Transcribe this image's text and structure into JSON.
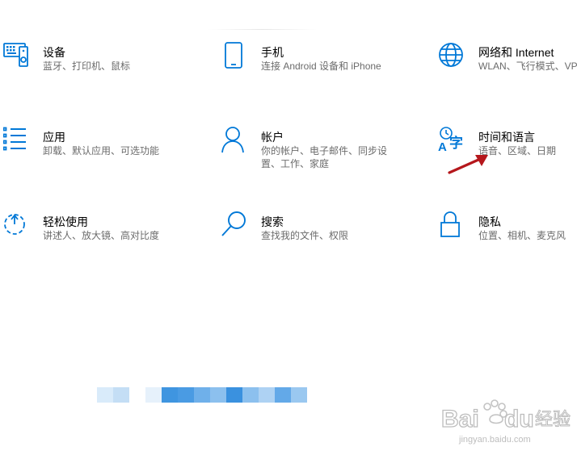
{
  "tiles": [
    {
      "key": "devices",
      "title": "设备",
      "desc": [
        "蓝牙、打印机、鼠标"
      ],
      "icon": "keyboard-speaker-icon"
    },
    {
      "key": "phone",
      "title": "手机",
      "desc": [
        "连接 Android 设备和 iPhone"
      ],
      "icon": "phone-icon"
    },
    {
      "key": "network",
      "title": "网络和 Internet",
      "desc": [
        "WLAN、飞行模式、VP"
      ],
      "icon": "globe-icon"
    },
    {
      "key": "apps",
      "title": "应用",
      "desc": [
        "卸载、默认应用、可选功能"
      ],
      "icon": "apps-list-icon"
    },
    {
      "key": "accounts",
      "title": "帐户",
      "desc": [
        "你的帐户、电子邮件、同步设",
        "置、工作、家庭"
      ],
      "icon": "person-icon"
    },
    {
      "key": "time-language",
      "title": "时间和语言",
      "desc": [
        "语音、区域、日期"
      ],
      "icon": "time-language-icon"
    },
    {
      "key": "ease-of-access",
      "title": "轻松使用",
      "desc": [
        "讲述人、放大镜、高对比度"
      ],
      "icon": "ease-of-access-icon"
    },
    {
      "key": "search",
      "title": "搜索",
      "desc": [
        "查找我的文件、权限"
      ],
      "icon": "search-icon"
    },
    {
      "key": "privacy",
      "title": "隐私",
      "desc": [
        "位置、相机、麦克风"
      ],
      "icon": "lock-icon"
    }
  ],
  "watermark": {
    "brand": "Baidu经验",
    "url": "jingyan.baidu.com",
    "icon": "paw-icon"
  },
  "colors": {
    "accent": "#0078d7",
    "annotation_arrow": "#b5171c",
    "desc_text": "#6b6b6b"
  }
}
